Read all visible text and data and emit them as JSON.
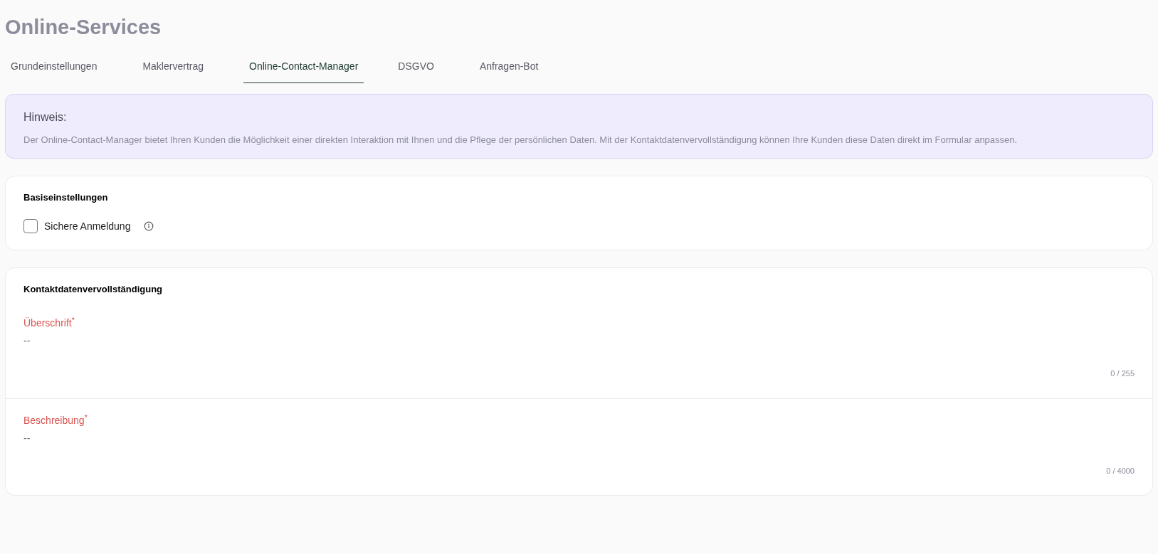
{
  "page": {
    "title": "Online-Services"
  },
  "tabs": [
    {
      "label": "Grundeinstellungen",
      "selected": false
    },
    {
      "label": "Maklervertrag",
      "selected": false
    },
    {
      "label": "Online-Contact-Manager",
      "selected": true
    },
    {
      "label": "DSGVO",
      "selected": false
    },
    {
      "label": "Anfragen-Bot",
      "selected": false
    }
  ],
  "notice": {
    "title": "Hinweis:",
    "text": "Der Online-Contact-Manager bietet Ihren Kunden die Möglichkeit einer direkten Interaktion mit Ihnen und die Pflege der persönlichen Daten. Mit der Kontaktdatenvervollständigung können Ihre Kunden diese Daten direkt im Formular anpassen."
  },
  "basic_settings": {
    "title": "Basiseinstellungen",
    "checkbox": {
      "label": "Sichere Anmeldung",
      "checked": false
    }
  },
  "contact_completion": {
    "title": "Kontaktdatenvervollständigung",
    "fields": [
      {
        "label": "Überschrift$^{*}$",
        "placeholder": "--",
        "counter": "0 / 255"
      },
      {
        "label": "Beschreibung$^{*}$",
        "placeholder": "--",
        "counter": "0 / 4000"
      }
    ]
  }
}
